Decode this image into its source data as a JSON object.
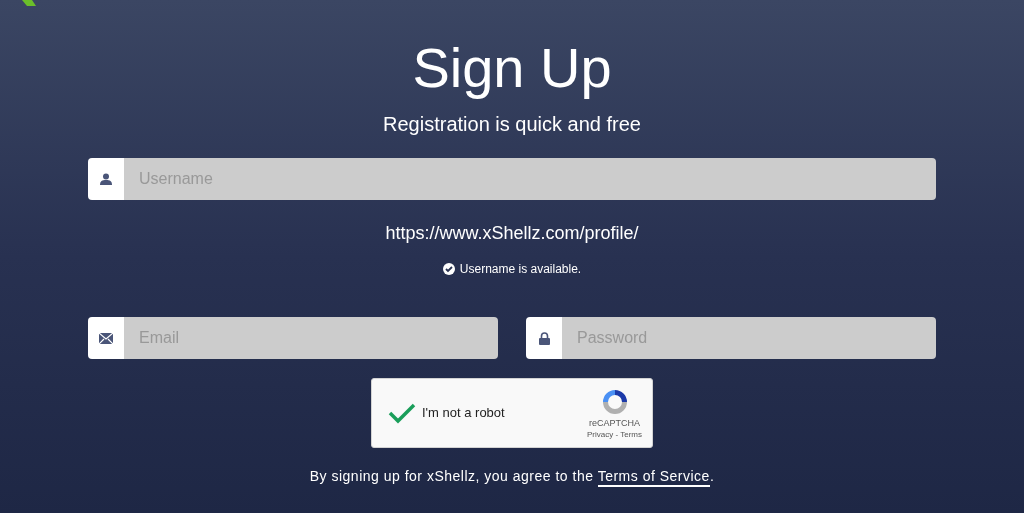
{
  "title": "Sign Up",
  "subtitle": "Registration is quick and free",
  "username": {
    "placeholder": "Username"
  },
  "profile_url": "https://www.xShellz.com/profile/",
  "availability": {
    "text": "Username is available.",
    "available": true
  },
  "email": {
    "placeholder": "Email"
  },
  "password": {
    "placeholder": "Password"
  },
  "captcha": {
    "label": "I'm not a robot",
    "checked": true,
    "brand": "reCAPTCHA",
    "links": "Privacy - Terms"
  },
  "agreement": {
    "before": "By signing up for xShellz, you agree to the ",
    "link": "Terms of Service",
    "after": "."
  }
}
